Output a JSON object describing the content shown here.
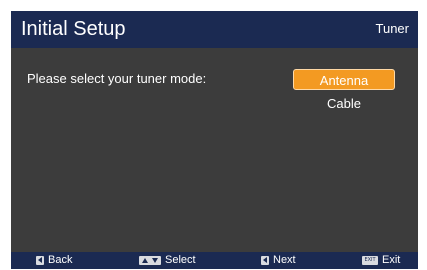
{
  "header": {
    "title": "Initial Setup",
    "section": "Tuner"
  },
  "main": {
    "prompt": "Please select your tuner mode:",
    "options": [
      {
        "label": "Antenna",
        "selected": true
      },
      {
        "label": "Cable",
        "selected": false
      }
    ]
  },
  "footer": {
    "back": {
      "icon": "left-arrow-key-icon",
      "label": "Back"
    },
    "select": {
      "icon": "up-down-keys-icon",
      "label": "Select"
    },
    "next": {
      "icon": "left-arrow-key-icon",
      "label": "Next"
    },
    "exit": {
      "icon": "exit-key-icon",
      "key_text": "EXIT",
      "label": "Exit"
    }
  },
  "colors": {
    "header_bar": "#1b2a52",
    "panel_background": "#3c3c3c",
    "selection_highlight": "#f39a22",
    "text": "#ffffff"
  }
}
